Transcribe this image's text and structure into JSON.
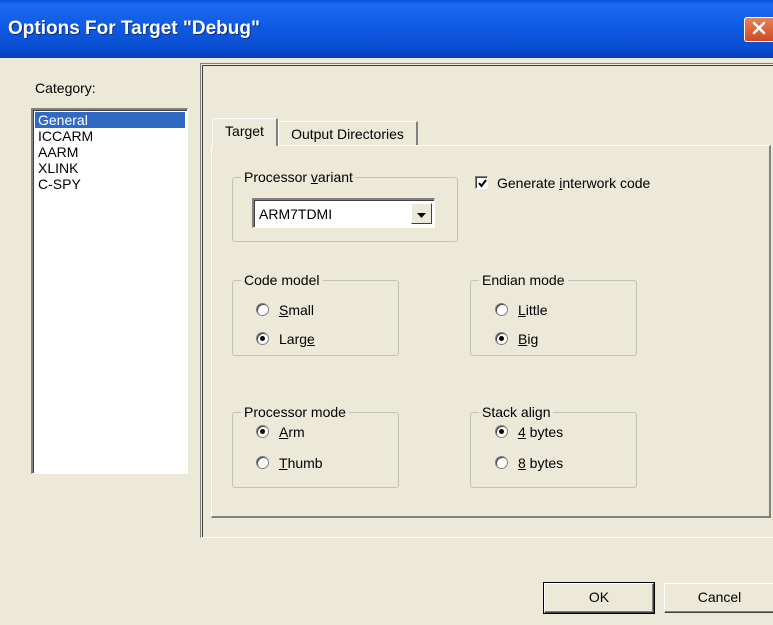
{
  "window": {
    "title": "Options For Target \"Debug\""
  },
  "category": {
    "label": "Category:",
    "items": [
      "General",
      "ICCARM",
      "AARM",
      "XLINK",
      "C-SPY"
    ],
    "selected": "General"
  },
  "tabs": {
    "target": "Target",
    "output_directories": "Output Directories",
    "active": "Target"
  },
  "processor_variant": {
    "legend_pre": "Processor ",
    "legend_key": "v",
    "legend_post": "ariant",
    "value": "ARM7TDMI"
  },
  "interwork": {
    "label_pre": "Generate ",
    "label_key": "i",
    "label_post": "nterwork code",
    "checked": true
  },
  "code_model": {
    "legend": "Code model",
    "small_key": "S",
    "small_rest": "mall",
    "large_pre": "Larg",
    "large_key": "e",
    "selected": "Large"
  },
  "endian_mode": {
    "legend": "Endian mode",
    "little_key": "L",
    "little_rest": "ittle",
    "big_key": "B",
    "big_rest": "ig",
    "selected": "Big"
  },
  "processor_mode": {
    "legend": "Processor mode",
    "arm_key": "A",
    "arm_rest": "rm",
    "thumb_key": "T",
    "thumb_rest": "humb",
    "selected": "Arm"
  },
  "stack_align": {
    "legend": "Stack align",
    "four_key": "4",
    "four_rest": " bytes",
    "eight_key": "8",
    "eight_rest": " bytes",
    "selected": "4 bytes"
  },
  "buttons": {
    "ok": "OK",
    "cancel": "Cancel"
  },
  "colors": {
    "title_bar": "#0a4fd6",
    "selection": "#316ac5",
    "dialog_bg": "#ece9d8",
    "close_button": "#cf4a22"
  },
  "icons": {
    "close": "close-icon",
    "dropdown": "chevron-down-icon",
    "check": "checkmark-icon"
  }
}
